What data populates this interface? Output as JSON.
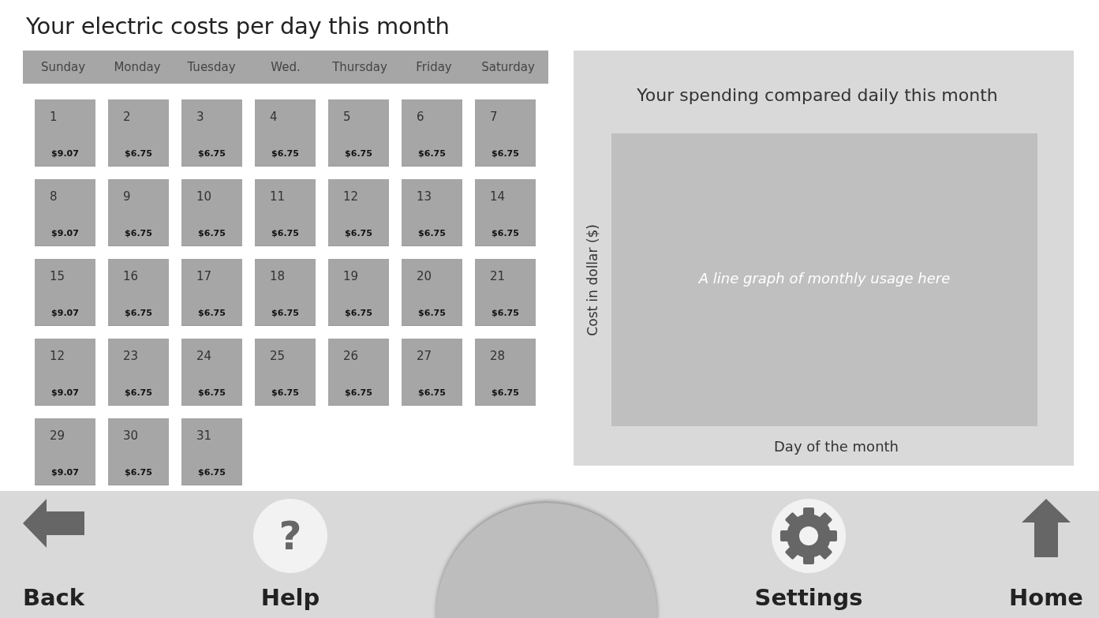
{
  "title": "Your electric costs per day this month",
  "calendar": {
    "weekdays": [
      "Sunday",
      "Monday",
      "Tuesday",
      "Wed.",
      "Thursday",
      "Friday",
      "Saturday"
    ],
    "weeks": [
      [
        {
          "day": "1",
          "cost": "$9.07"
        },
        {
          "day": "2",
          "cost": "$6.75"
        },
        {
          "day": "3",
          "cost": "$6.75"
        },
        {
          "day": "4",
          "cost": "$6.75"
        },
        {
          "day": "5",
          "cost": "$6.75"
        },
        {
          "day": "6",
          "cost": "$6.75"
        },
        {
          "day": "7",
          "cost": "$6.75"
        }
      ],
      [
        {
          "day": "8",
          "cost": "$9.07"
        },
        {
          "day": "9",
          "cost": "$6.75"
        },
        {
          "day": "10",
          "cost": "$6.75"
        },
        {
          "day": "11",
          "cost": "$6.75"
        },
        {
          "day": "12",
          "cost": "$6.75"
        },
        {
          "day": "13",
          "cost": "$6.75"
        },
        {
          "day": "14",
          "cost": "$6.75"
        }
      ],
      [
        {
          "day": "15",
          "cost": "$9.07"
        },
        {
          "day": "16",
          "cost": "$6.75"
        },
        {
          "day": "17",
          "cost": "$6.75"
        },
        {
          "day": "18",
          "cost": "$6.75"
        },
        {
          "day": "19",
          "cost": "$6.75"
        },
        {
          "day": "20",
          "cost": "$6.75"
        },
        {
          "day": "21",
          "cost": "$6.75"
        }
      ],
      [
        {
          "day": "12",
          "cost": "$9.07"
        },
        {
          "day": "23",
          "cost": "$6.75"
        },
        {
          "day": "24",
          "cost": "$6.75"
        },
        {
          "day": "25",
          "cost": "$6.75"
        },
        {
          "day": "26",
          "cost": "$6.75"
        },
        {
          "day": "27",
          "cost": "$6.75"
        },
        {
          "day": "28",
          "cost": "$6.75"
        }
      ],
      [
        {
          "day": "29",
          "cost": "$9.07"
        },
        {
          "day": "30",
          "cost": "$6.75"
        },
        {
          "day": "31",
          "cost": "$6.75"
        }
      ]
    ]
  },
  "comparison": {
    "title": "Your spending compared daily this month",
    "placeholder_text": "A line graph of monthly usage here",
    "ylabel": "Cost in dollar ($)",
    "xlabel": "Day of the month"
  },
  "nav": [
    {
      "kind": "back",
      "label": "Back"
    },
    {
      "kind": "help",
      "label": "Help",
      "glyph": "?"
    },
    {
      "kind": "dial"
    },
    {
      "kind": "settings",
      "label": "Settings"
    },
    {
      "kind": "home",
      "label": "Home"
    }
  ]
}
